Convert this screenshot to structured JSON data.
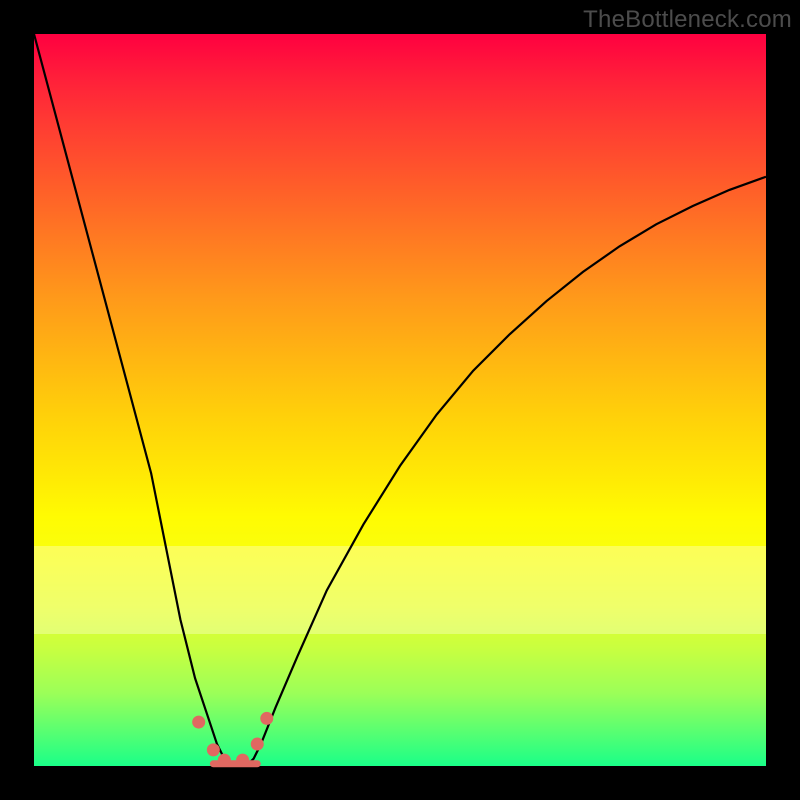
{
  "watermark": "TheBottleneck.com",
  "colors": {
    "frame": "#000000",
    "curve": "#000000",
    "marker": "#e06861",
    "grad_top": "#ff0040",
    "grad_mid": "#ffe805",
    "grad_bot": "#1aff88"
  },
  "chart_data": {
    "type": "line",
    "title": "",
    "xlabel": "",
    "ylabel": "",
    "xlim": [
      0,
      100
    ],
    "ylim": [
      0,
      100
    ],
    "grid": false,
    "x": [
      0,
      4,
      8,
      12,
      16,
      20,
      22,
      24,
      25,
      26,
      27,
      28,
      29,
      30,
      31,
      33,
      36,
      40,
      45,
      50,
      55,
      60,
      65,
      70,
      75,
      80,
      85,
      90,
      95,
      100
    ],
    "y": [
      100,
      85,
      70,
      55,
      40,
      20,
      12,
      6,
      3,
      1,
      0,
      0,
      0,
      1,
      3,
      8,
      15,
      24,
      33,
      41,
      48,
      54,
      59,
      63.5,
      67.5,
      71,
      74,
      76.5,
      78.7,
      80.5
    ],
    "markers": {
      "comment": "salmon dots near trough + thick salmon segment along the floor",
      "points_x": [
        22.5,
        24.5,
        26.0,
        28.5,
        30.5,
        31.8
      ],
      "points_y": [
        6.0,
        2.2,
        0.8,
        0.8,
        3.0,
        6.5
      ],
      "trough_segment": {
        "x0": 24.5,
        "x1": 30.5,
        "y": 0.3
      }
    }
  }
}
